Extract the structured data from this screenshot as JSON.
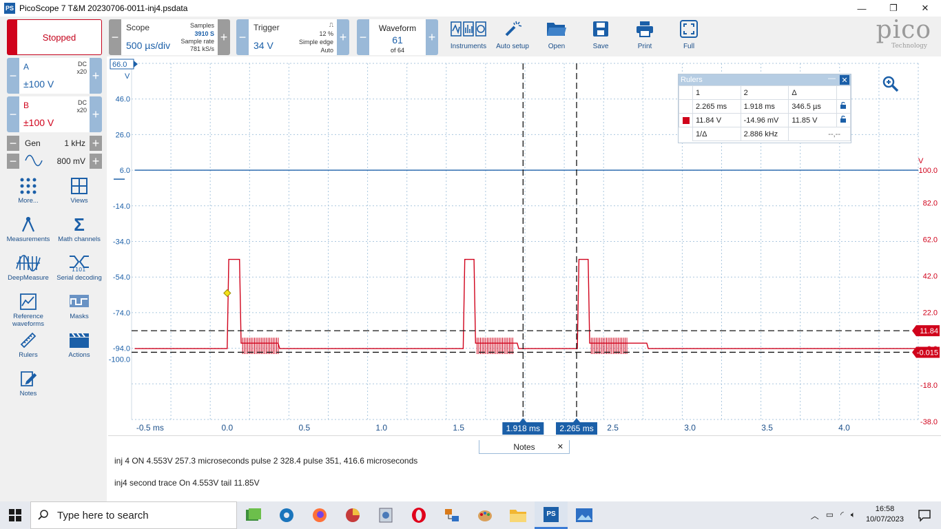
{
  "window": {
    "title": "PicoScope 7 T&M 20230706-0011-inj4.psdata",
    "app_icon_text": "PS",
    "minimize": "—",
    "maximize": "❐",
    "close": "✕"
  },
  "toolbar": {
    "run_state": "Stopped",
    "scope": {
      "label": "Scope",
      "value": "500 µs/div",
      "samples_label": "Samples",
      "samples_value": "3910 S",
      "rate_label": "Sample rate",
      "rate_value": "781 kS/s"
    },
    "trigger": {
      "label": "Trigger",
      "value": "34 V",
      "percent": "12 %",
      "type": "Simple edge",
      "mode": "Auto"
    },
    "waveform": {
      "label": "Waveform",
      "value": "61",
      "of": "of 64"
    },
    "tools": [
      {
        "id": "instruments",
        "label": "Instruments",
        "icon": "instruments-icon"
      },
      {
        "id": "auto-setup",
        "label": "Auto setup",
        "icon": "auto-setup-icon"
      },
      {
        "id": "open",
        "label": "Open",
        "icon": "folder-icon"
      },
      {
        "id": "save",
        "label": "Save",
        "icon": "save-icon"
      },
      {
        "id": "print",
        "label": "Print",
        "icon": "print-icon"
      },
      {
        "id": "full",
        "label": "Full",
        "icon": "fullscreen-icon"
      }
    ],
    "logo_text": "pico",
    "logo_sub": "Technology"
  },
  "channels": [
    {
      "name": "A",
      "coupling": "DC",
      "probe": "x20",
      "range": "±100 V",
      "color": "#1b5fa8"
    },
    {
      "name": "B",
      "coupling": "DC",
      "probe": "x20",
      "range": "±100 V",
      "color": "#d0021b"
    }
  ],
  "generator": {
    "label": "Gen",
    "freq": "1 kHz",
    "amplitude": "800 mV"
  },
  "left_tools": [
    {
      "id": "more",
      "label": "More...",
      "icon": "more-dots-icon"
    },
    {
      "id": "views",
      "label": "Views",
      "icon": "views-grid-icon"
    },
    {
      "id": "measurements",
      "label": "Measurements",
      "icon": "measurements-icon"
    },
    {
      "id": "math",
      "label": "Math channels",
      "icon": "sigma-icon"
    },
    {
      "id": "deepmeasure",
      "label": "DeepMeasure",
      "icon": "deepmeasure-icon"
    },
    {
      "id": "serial",
      "label": "Serial decoding",
      "icon": "serial-decoding-icon"
    },
    {
      "id": "reference",
      "label": "Reference waveforms",
      "icon": "reference-waveforms-icon"
    },
    {
      "id": "masks",
      "label": "Masks",
      "icon": "masks-icon"
    },
    {
      "id": "rulers",
      "label": "Rulers",
      "icon": "ruler-icon"
    },
    {
      "id": "actions",
      "label": "Actions",
      "icon": "actions-icon"
    },
    {
      "id": "notes",
      "label": "Notes",
      "icon": "notes-icon"
    }
  ],
  "scope_view": {
    "left_axis_unit": "V",
    "right_axis_unit": "V",
    "left_axis_top": "66.0",
    "left_ticks": [
      "46.0",
      "26.0",
      "6.0",
      "-14.0",
      "-34.0",
      "-54.0",
      "-74.0",
      "-94.0",
      "-100.0"
    ],
    "right_ticks": [
      "100.0",
      "82.0",
      "62.0",
      "42.0",
      "22.0",
      "2.0",
      "-18.0",
      "-38.0"
    ],
    "x_ticks": [
      "-0.5 ms",
      "0.0",
      "0.5",
      "1.0",
      "1.5",
      "2.0",
      "2.5",
      "3.0",
      "3.5",
      "4.0"
    ],
    "ruler_time_labels": [
      "1.918 ms",
      "2.265 ms"
    ],
    "ruler_volt_labels": [
      "11.84",
      "-0.015"
    ]
  },
  "chart_data": {
    "type": "line",
    "xlabel": "",
    "xlim": [
      -0.5,
      4.0
    ],
    "series": [
      {
        "name": "A",
        "color": "#1b5fa8",
        "x": [
          -0.6,
          4.5
        ],
        "y": [
          6.0,
          6.0
        ]
      },
      {
        "name": "B",
        "color": "#d0021b",
        "x": [
          -0.6,
          0.0,
          0.01,
          0.08,
          0.09,
          0.33,
          0.34,
          1.53,
          1.54,
          1.6,
          1.61,
          1.88,
          1.89,
          2.27,
          2.28,
          2.34,
          2.35,
          2.72,
          2.73,
          4.5
        ],
        "y": [
          2.0,
          2.0,
          51.0,
          51.0,
          5.0,
          5.0,
          2.0,
          2.0,
          51.0,
          51.0,
          5.0,
          5.0,
          2.0,
          2.0,
          51.0,
          51.0,
          5.0,
          5.0,
          2.0,
          2.0
        ]
      }
    ],
    "rulers": {
      "time": [
        1.918,
        2.265
      ],
      "voltage": [
        11.84,
        -0.015
      ]
    }
  },
  "rulers_panel": {
    "title": "Rulers",
    "headers": [
      "1",
      "2",
      "Δ"
    ],
    "time_row": [
      "2.265 ms",
      "1.918 ms",
      "346.5 µs"
    ],
    "volt_row": [
      "11.84 V",
      "-14.96 mV",
      "11.85 V"
    ],
    "freq_label": "1/Δ",
    "freq_value": "2.886 kHz",
    "freq_extra": "--,--"
  },
  "notes": {
    "tab": "Notes",
    "line1": "inj 4  ON 4.553V 257.3 microseconds pulse 2 328.4 pulse 351, 416.6 microseconds",
    "line2": "inj4 second trace On 4.553V tail 11.85V"
  },
  "taskbar": {
    "search_placeholder": "Type here to search",
    "time": "16:58",
    "date": "10/07/2023"
  }
}
